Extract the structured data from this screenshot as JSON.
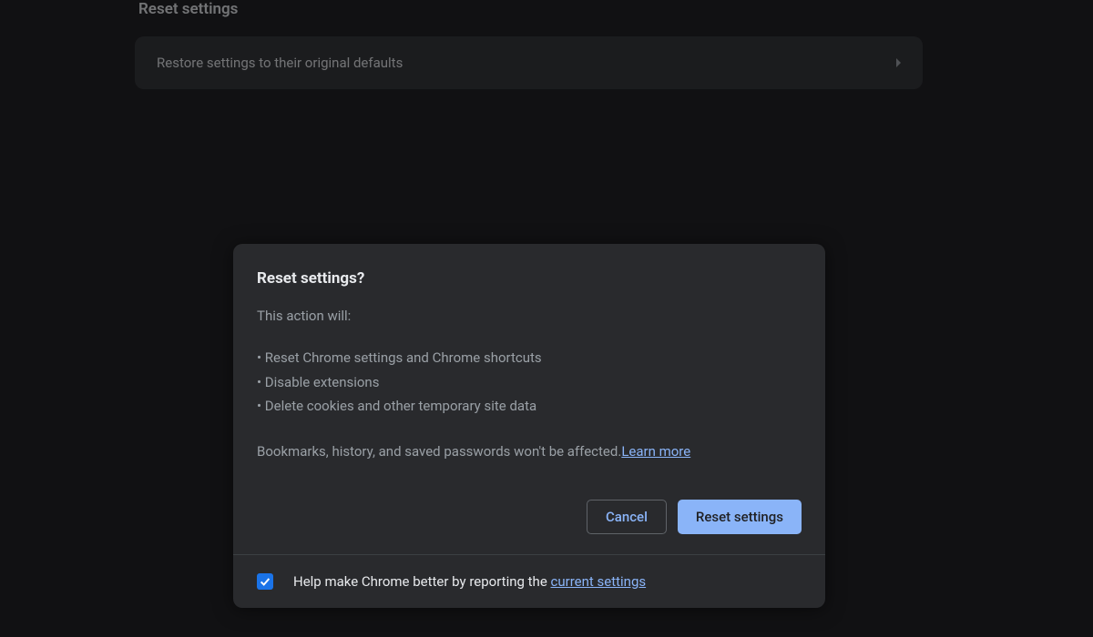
{
  "background": {
    "section_heading": "Reset settings",
    "row_label": "Restore settings to their original defaults"
  },
  "modal": {
    "title": "Reset settings?",
    "intro": "This action will:",
    "bullets": [
      "Reset Chrome settings and Chrome shortcuts",
      "Disable extensions",
      "Delete cookies and other temporary site data"
    ],
    "footer_text": "Bookmarks, history, and saved passwords won't be affected.",
    "learn_more": "Learn more",
    "cancel": "Cancel",
    "confirm": "Reset settings",
    "report_prefix": "Help make Chrome better by reporting the ",
    "report_link": "current settings",
    "report_checked": true
  }
}
